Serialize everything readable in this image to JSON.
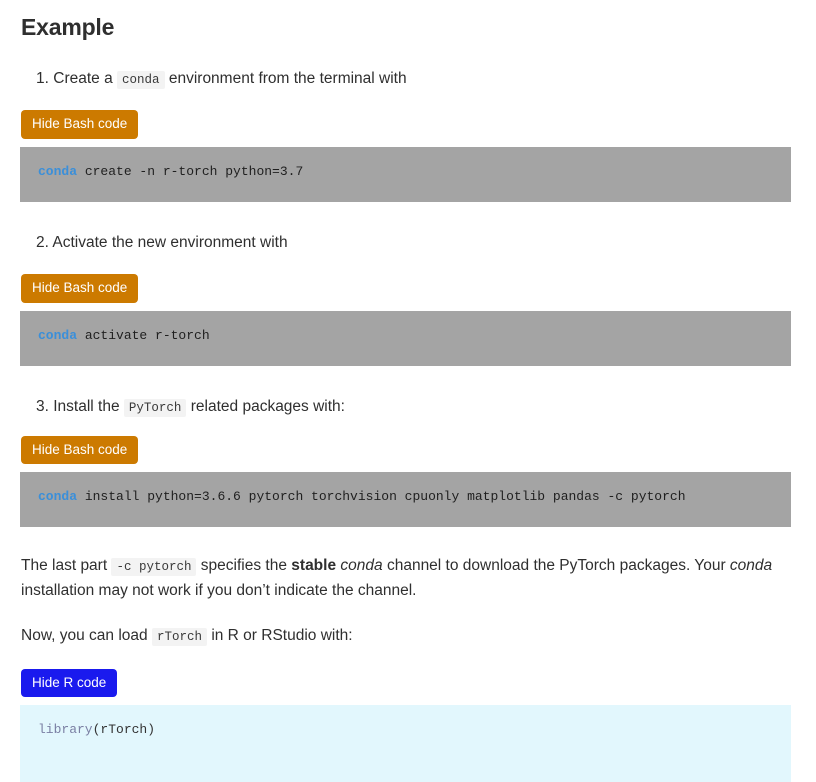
{
  "heading": "Example",
  "steps": [
    {
      "number": "1.",
      "text_before": "Create a",
      "inline_code": "conda",
      "text_after": "environment from the terminal with",
      "button_label": "Hide Bash code",
      "code_keyword": "conda",
      "code_rest": " create -n r-torch python=3.7"
    },
    {
      "number": "2.",
      "text_before": "Activate the new environment with",
      "inline_code": "",
      "text_after": "",
      "button_label": "Hide Bash code",
      "code_keyword": "conda",
      "code_rest": " activate r-torch"
    },
    {
      "number": "3.",
      "text_before": "Install the",
      "inline_code": "PyTorch",
      "text_after": "related packages with:",
      "button_label": "Hide Bash code",
      "code_keyword": "conda",
      "code_rest": " install python=3.6.6 pytorch torchvision cpuonly matplotlib pandas -c pytorch"
    }
  ],
  "paragraph_channel": {
    "part1": "The last part",
    "code": "-c pytorch",
    "part2": "specifies the",
    "bold": "stable",
    "italic1": "conda",
    "part3": "channel to download the PyTorch packages. Your",
    "italic2": "conda",
    "part4": "installation may not work if you don’t indicate the channel."
  },
  "paragraph_load": {
    "part1": "Now, you can load",
    "code": "rTorch",
    "part2": "in R or RStudio with:"
  },
  "r_section": {
    "button_label": "Hide R code",
    "code_keyword": "library",
    "code_rest": "(rTorch)"
  },
  "colors": {
    "bash_button": "#cc7a00",
    "r_button": "#1a1aee",
    "bash_block": "#a4a4a4",
    "r_block": "#e2f7fd",
    "keyword": "#3b8fd9"
  }
}
